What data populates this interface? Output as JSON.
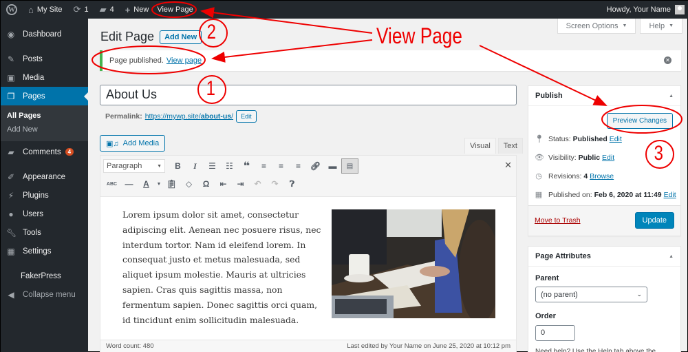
{
  "admin_bar": {
    "site_name": "My Site",
    "updates_count": "1",
    "comments_count": "4",
    "new_label": "New",
    "view_page_label": "View Page",
    "greeting": "Howdy, Your Name"
  },
  "sidebar": {
    "items": [
      {
        "label": "Dashboard",
        "icon": "dashboard-icon"
      },
      {
        "label": "Posts",
        "icon": "pin-icon"
      },
      {
        "label": "Media",
        "icon": "media-icon"
      },
      {
        "label": "Pages",
        "icon": "pages-icon",
        "current": true
      },
      {
        "label": "Comments",
        "icon": "comment-icon",
        "badge": "4"
      },
      {
        "label": "Appearance",
        "icon": "paintbrush-icon"
      },
      {
        "label": "Plugins",
        "icon": "plug-icon"
      },
      {
        "label": "Users",
        "icon": "user-icon"
      },
      {
        "label": "Tools",
        "icon": "wrench-icon"
      },
      {
        "label": "Settings",
        "icon": "settings-icon"
      },
      {
        "label": "FakerPress"
      },
      {
        "label": "Collapse menu",
        "icon": "collapse-icon"
      }
    ],
    "submenu": [
      {
        "label": "All Pages",
        "active": true
      },
      {
        "label": "Add New"
      }
    ]
  },
  "screen_meta": {
    "screen_options": "Screen Options",
    "help": "Help"
  },
  "heading": {
    "title": "Edit Page",
    "add_new": "Add New"
  },
  "notice": {
    "text": "Page published.",
    "link": "View page"
  },
  "post": {
    "title": "About Us",
    "permalink_label": "Permalink:",
    "permalink_base": "https://mywp.site/",
    "permalink_slug": "about-us",
    "permalink_trail": "/",
    "permalink_edit": "Edit"
  },
  "editor": {
    "add_media": "Add Media",
    "tab_visual": "Visual",
    "tab_text": "Text",
    "format": "Paragraph",
    "body": "Lorem ipsum dolor sit amet, consectetur adipiscing elit. Aenean nec posuere risus, nec interdum tortor. Nam id eleifend lorem. In consequat justo et metus malesuada, sed aliquet ipsum molestie. Mauris at ultricies sapien. Cras quis sagittis massa, non fermentum sapien. Donec sagittis orci quam, id tincidunt enim sollicitudin malesuada.",
    "image_alt": "People working at a table with laptop, notebook and coffee cup",
    "word_count": "Word count: 480",
    "last_edited": "Last edited by Your Name on June 25, 2020 at 10:12 pm",
    "toolbar_row1": [
      "bold",
      "italic",
      "bulleted-list",
      "numbered-list",
      "blockquote",
      "align-left",
      "align-center",
      "align-right",
      "link",
      "read-more",
      "toolbar-toggle"
    ],
    "toolbar_row2": [
      "strikethrough",
      "horizontal-line",
      "text-color",
      "paste-as-text",
      "clear-formatting",
      "special-character",
      "outdent",
      "indent",
      "undo",
      "redo",
      "help"
    ]
  },
  "publish": {
    "title": "Publish",
    "preview": "Preview Changes",
    "status_label": "Status:",
    "status_value": "Published",
    "visibility_label": "Visibility:",
    "visibility_value": "Public",
    "revisions_label": "Revisions:",
    "revisions_value": "4",
    "revisions_link": "Browse",
    "published_label": "Published on:",
    "published_value": "Feb 6, 2020 at 11:49",
    "edit": "Edit",
    "trash": "Move to Trash",
    "update": "Update"
  },
  "page_attributes": {
    "title": "Page Attributes",
    "parent_label": "Parent",
    "parent_value": "(no parent)",
    "order_label": "Order",
    "order_value": "0",
    "help_text": "Need help? Use the Help tab above the"
  },
  "annotations": {
    "label": "View Page",
    "numbers": [
      "1",
      "2",
      "3"
    ],
    "color": "#e00000"
  }
}
